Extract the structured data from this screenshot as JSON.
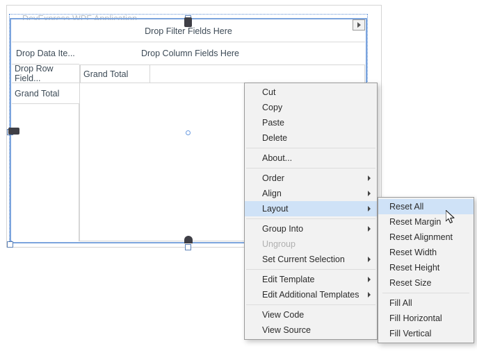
{
  "window": {
    "app_title": "DevExpress WPF Application"
  },
  "pivot": {
    "filter_fields": "Drop Filter Fields Here",
    "data_items": "Drop Data Ite...",
    "column_fields": "Drop Column Fields Here",
    "row_fields": "Drop Row Field...",
    "grand_total_row": "Grand Total",
    "grand_total_column": "Grand Total"
  },
  "context_menu": {
    "items": [
      {
        "label": "Cut",
        "type": "item",
        "submenu": false,
        "selected": false,
        "disabled": false
      },
      {
        "label": "Copy",
        "type": "item",
        "submenu": false,
        "selected": false,
        "disabled": false
      },
      {
        "label": "Paste",
        "type": "item",
        "submenu": false,
        "selected": false,
        "disabled": false
      },
      {
        "label": "Delete",
        "type": "item",
        "submenu": false,
        "selected": false,
        "disabled": false
      },
      {
        "label": "",
        "type": "separator"
      },
      {
        "label": "About...",
        "type": "item",
        "submenu": false,
        "selected": false,
        "disabled": false
      },
      {
        "label": "",
        "type": "separator"
      },
      {
        "label": "Order",
        "type": "item",
        "submenu": true,
        "selected": false,
        "disabled": false
      },
      {
        "label": "Align",
        "type": "item",
        "submenu": true,
        "selected": false,
        "disabled": false
      },
      {
        "label": "Layout",
        "type": "item",
        "submenu": true,
        "selected": true,
        "disabled": false
      },
      {
        "label": "",
        "type": "separator"
      },
      {
        "label": "Group Into",
        "type": "item",
        "submenu": true,
        "selected": false,
        "disabled": false
      },
      {
        "label": "Ungroup",
        "type": "item",
        "submenu": false,
        "selected": false,
        "disabled": true
      },
      {
        "label": "Set Current Selection",
        "type": "item",
        "submenu": true,
        "selected": false,
        "disabled": false
      },
      {
        "label": "",
        "type": "separator"
      },
      {
        "label": "Edit Template",
        "type": "item",
        "submenu": true,
        "selected": false,
        "disabled": false
      },
      {
        "label": "Edit Additional Templates",
        "type": "item",
        "submenu": true,
        "selected": false,
        "disabled": false
      },
      {
        "label": "",
        "type": "separator"
      },
      {
        "label": "View Code",
        "type": "item",
        "submenu": false,
        "selected": false,
        "disabled": false
      },
      {
        "label": "View Source",
        "type": "item",
        "submenu": false,
        "selected": false,
        "disabled": false
      }
    ]
  },
  "layout_submenu": {
    "items": [
      {
        "label": "Reset All",
        "type": "item",
        "selected": true
      },
      {
        "label": "Reset Margin",
        "type": "item",
        "selected": false
      },
      {
        "label": "Reset Alignment",
        "type": "item",
        "selected": false
      },
      {
        "label": "Reset Width",
        "type": "item",
        "selected": false
      },
      {
        "label": "Reset Height",
        "type": "item",
        "selected": false
      },
      {
        "label": "Reset Size",
        "type": "item",
        "selected": false
      },
      {
        "label": "",
        "type": "separator"
      },
      {
        "label": "Fill All",
        "type": "item",
        "selected": false
      },
      {
        "label": "Fill Horizontal",
        "type": "item",
        "selected": false
      },
      {
        "label": "Fill Vertical",
        "type": "item",
        "selected": false
      }
    ]
  },
  "colors": {
    "menu_background": "#f2f2f2",
    "menu_border": "#9a9a9a",
    "highlight": "#cfe2f7",
    "selection_frame": "#7ba4dd",
    "disabled_text": "#b0b0b0",
    "title_text": "#b9bfc6"
  }
}
